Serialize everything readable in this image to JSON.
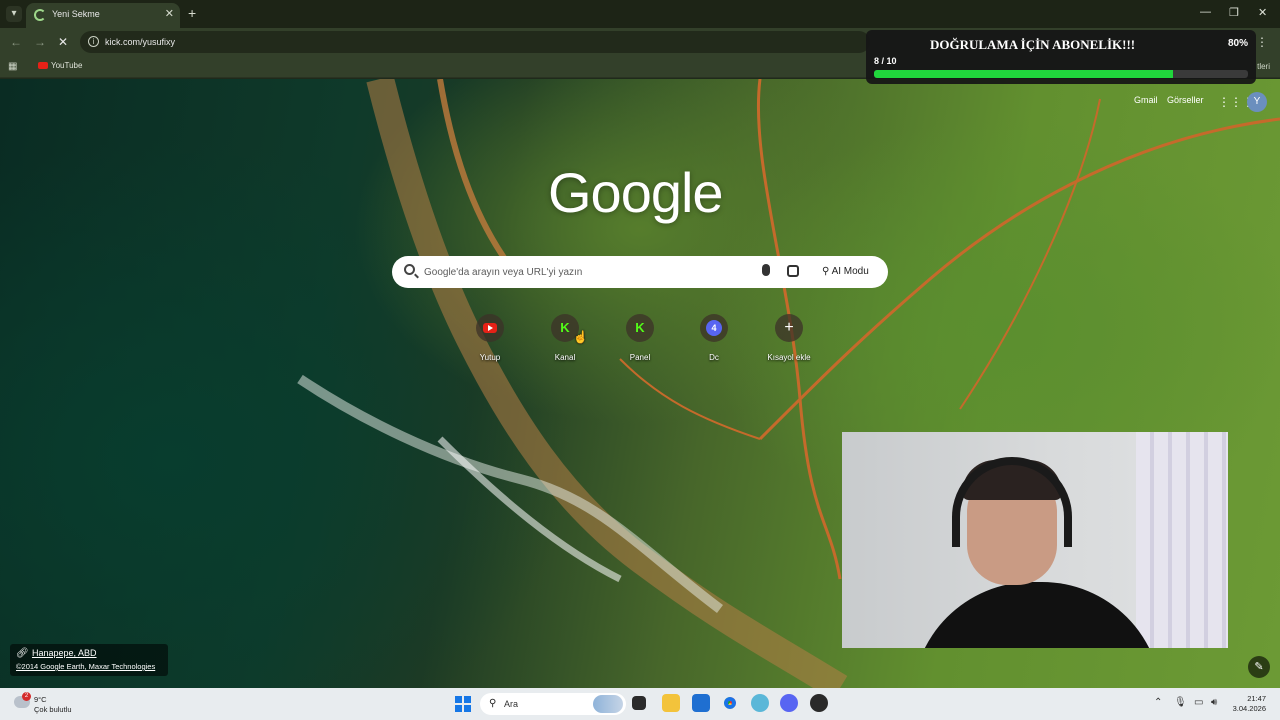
{
  "browser": {
    "tab_title": "Yeni Sekme",
    "url": "kick.com/yusufixy",
    "bookmarks": [
      {
        "label": "YouTube",
        "icon": "youtube-icon"
      }
    ],
    "bookmarks_right_partial": "tleri"
  },
  "ntp": {
    "links": [
      "Gmail",
      "Görseller"
    ],
    "avatar_letter": "Y",
    "logo": "Google",
    "search_placeholder": "Google'da arayın veya URL'yi yazın",
    "ai_mode_label": "AI Modu",
    "shortcuts": [
      {
        "label": "Yutup",
        "icon": "youtube-icon",
        "color": "#e62117"
      },
      {
        "label": "Kanal",
        "icon": "kick-icon",
        "glyph": "K",
        "color": "#53fc18"
      },
      {
        "label": "Panel",
        "icon": "kick-icon",
        "glyph": "K",
        "color": "#53fc18"
      },
      {
        "label": "Dc",
        "icon": "discord-icon",
        "glyph": "4",
        "color": "#5865f2"
      },
      {
        "label": "Kısayol ekle",
        "icon": "plus-icon",
        "glyph": "+",
        "color": "#ffffff"
      }
    ],
    "attribution_place": "Hanapepe, ABD",
    "attribution_copy": "©2014 Google Earth, Maxar Technologies"
  },
  "overlay": {
    "title": "DOĞRULAMA İÇİN ABONELİK!!!",
    "count": "8 / 10",
    "percent_label": "80%",
    "progress": 0.8,
    "bar_color": "#20d63c"
  },
  "taskbar": {
    "weather_temp": "9°C",
    "weather_desc": "Çok bulutlu",
    "weather_badge": "2",
    "search_label": "Ara",
    "time": "21:47",
    "date": "3.04.2026"
  }
}
